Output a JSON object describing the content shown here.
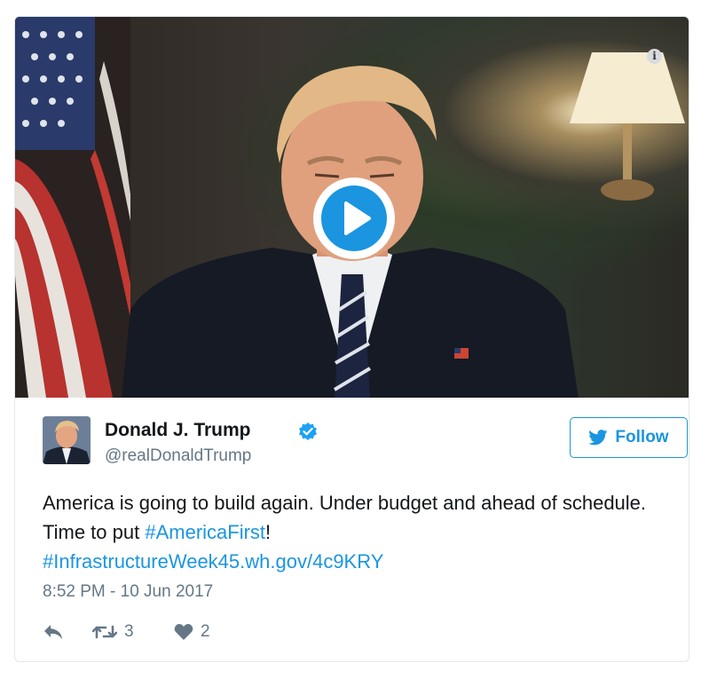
{
  "video": {
    "play_icon": "play-icon",
    "info_icon": "info-icon",
    "info_glyph": "i"
  },
  "author": {
    "name": "Donald J. Trump",
    "handle": "@realDonaldTrump",
    "verified_icon": "verified-badge-icon"
  },
  "follow": {
    "label": "Follow",
    "icon": "twitter-bird-icon"
  },
  "tweet": {
    "text_part1": "America is going to build again. Under budget and ahead of schedule. Time to put ",
    "hashtag1": "#AmericaFirst",
    "text_part2": "!",
    "hashtag2": "#InfrastructureWeek45.wh.gov/4c9KRY",
    "timestamp": "8:52 PM - 10 Jun 2017"
  },
  "actions": {
    "reply_icon": "reply-icon",
    "retweet_icon": "retweet-icon",
    "retweet_count": "3",
    "like_icon": "heart-icon",
    "like_count": "2"
  },
  "colors": {
    "accent": "#1b95e0",
    "secondary_text": "#657786",
    "primary_text": "#14171a",
    "border": "#e1e8ed"
  }
}
